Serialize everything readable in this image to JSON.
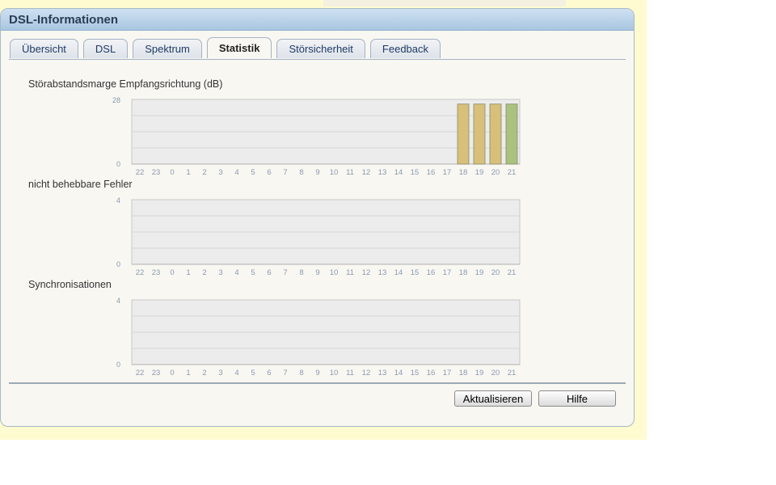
{
  "panel": {
    "title": "DSL-Informationen"
  },
  "tabs": [
    {
      "label": "Übersicht",
      "active": false
    },
    {
      "label": "DSL",
      "active": false
    },
    {
      "label": "Spektrum",
      "active": false
    },
    {
      "label": "Statistik",
      "active": true
    },
    {
      "label": "Störsicherheit",
      "active": false
    },
    {
      "label": "Feedback",
      "active": false
    }
  ],
  "buttons": {
    "refresh": "Aktualisieren",
    "help": "Hilfe"
  },
  "colors": {
    "bar_a": "#d8c07a",
    "bar_b": "#a9c27e",
    "grid_bg": "#ececec",
    "axis_text": "#8a9aae"
  },
  "chart_data": [
    {
      "type": "bar",
      "title": "Störabstandsmarge Empfangsrichtung (dB)",
      "categories": [
        "22",
        "23",
        "0",
        "1",
        "2",
        "3",
        "4",
        "5",
        "6",
        "7",
        "8",
        "9",
        "10",
        "11",
        "12",
        "13",
        "14",
        "15",
        "16",
        "17",
        "18",
        "19",
        "20",
        "21"
      ],
      "values": [
        null,
        null,
        null,
        null,
        null,
        null,
        null,
        null,
        null,
        null,
        null,
        null,
        null,
        null,
        null,
        null,
        null,
        null,
        null,
        null,
        26,
        26,
        26,
        26
      ],
      "ylim": [
        0,
        28
      ],
      "yticks": [
        "28",
        "0"
      ],
      "grid": true
    },
    {
      "type": "bar",
      "title": "nicht behebbare Fehler",
      "categories": [
        "22",
        "23",
        "0",
        "1",
        "2",
        "3",
        "4",
        "5",
        "6",
        "7",
        "8",
        "9",
        "10",
        "11",
        "12",
        "13",
        "14",
        "15",
        "16",
        "17",
        "18",
        "19",
        "20",
        "21"
      ],
      "values": [],
      "ylim": [
        0,
        4
      ],
      "yticks": [
        "4",
        "0"
      ],
      "grid": true
    },
    {
      "type": "bar",
      "title": "Synchronisationen",
      "categories": [
        "22",
        "23",
        "0",
        "1",
        "2",
        "3",
        "4",
        "5",
        "6",
        "7",
        "8",
        "9",
        "10",
        "11",
        "12",
        "13",
        "14",
        "15",
        "16",
        "17",
        "18",
        "19",
        "20",
        "21"
      ],
      "values": [],
      "ylim": [
        0,
        4
      ],
      "yticks": [
        "4",
        "0"
      ],
      "grid": true
    }
  ]
}
